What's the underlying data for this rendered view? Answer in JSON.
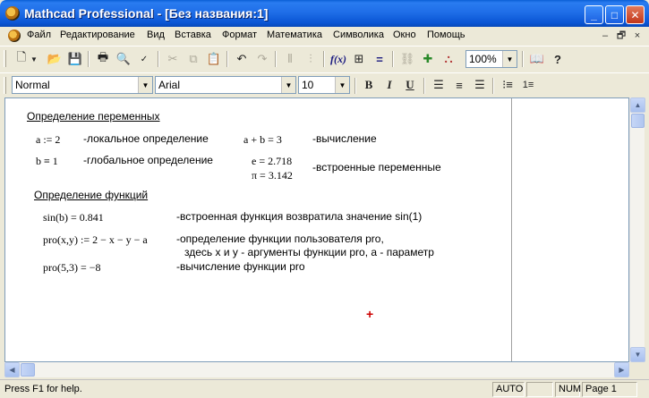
{
  "window": {
    "title": "Mathcad Professional - [Без названия:1]",
    "minimize": "_",
    "maximize": "□",
    "close": "✕"
  },
  "menu": {
    "items": [
      "Файл",
      "Редактирование",
      "Вид",
      "Вставка",
      "Формат",
      "Математика",
      "Символика",
      "Окно",
      "Помощь"
    ],
    "mdi_min": "–",
    "mdi_restore": "🗗",
    "mdi_close": "×"
  },
  "toolbar": {
    "zoom": "100%",
    "help_icon": "?"
  },
  "format": {
    "style": "Normal",
    "font": "Arial",
    "size": "10",
    "bold": "B",
    "italic": "I",
    "underline": "U"
  },
  "worksheet": {
    "heading_vars": "Определение переменных",
    "a_def": "a := 2",
    "a_comment": "-локальное определение",
    "sum_expr": "a + b = 3",
    "sum_comment": "-вычисление",
    "b_def": "b ≡ 1",
    "b_comment": "-глобальное определение",
    "e_val": "e = 2.718",
    "pi_val": "π = 3.142",
    "builtin_comment": "-встроенные переменные",
    "heading_funcs": "Определение функций",
    "sin_expr": "sin(b) = 0.841",
    "sin_comment": "-встроенная функция возвратила значение sin(1)",
    "pro_def": "pro(x,y) := 2 − x − y − a",
    "pro_comment1": "-определение функции пользователя pro,",
    "pro_comment2": "здесь x и y - аргументы функции pro, a - параметр",
    "pro_eval": "pro(5,3) = −8",
    "pro_eval_comment": "-вычисление функции pro",
    "cursor": "+"
  },
  "status": {
    "help": "Press F1 for help.",
    "auto": "AUTO",
    "num": "NUM",
    "page": "Page 1"
  }
}
